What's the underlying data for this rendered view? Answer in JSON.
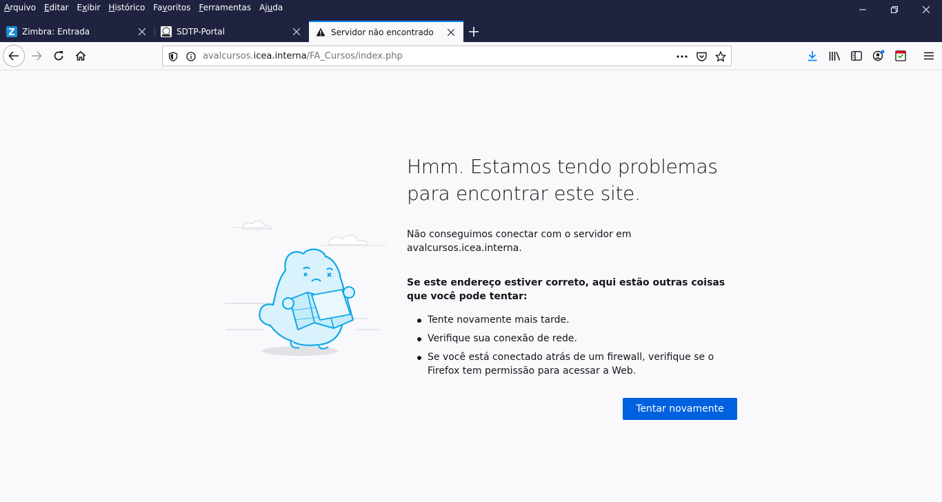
{
  "menubar": {
    "items": [
      {
        "pre": "",
        "key": "A",
        "post": "rquivo"
      },
      {
        "pre": "",
        "key": "E",
        "post": "ditar"
      },
      {
        "pre": "E",
        "key": "x",
        "post": "ibir"
      },
      {
        "pre": "",
        "key": "H",
        "post": "istórico"
      },
      {
        "pre": "Fa",
        "key": "v",
        "post": "oritos"
      },
      {
        "pre": "",
        "key": "F",
        "post": "erramentas"
      },
      {
        "pre": "Aj",
        "key": "u",
        "post": "da"
      }
    ]
  },
  "tabs": [
    {
      "title": "Zimbra: Entrada",
      "icon": "zimbra-icon"
    },
    {
      "title": "SDTP-Portal",
      "icon": "sdtp-icon"
    },
    {
      "title": "Servidor não encontrado",
      "icon": "warning-icon"
    }
  ],
  "urlbar": {
    "prefix": "avalcursos.",
    "domain": "icea.interna",
    "path": "/FA_Cursos/index.php"
  },
  "error": {
    "title_line1": "Hmm. Estamos tendo problemas",
    "title_line2": "para encontrar este site.",
    "lead": "Não conseguimos conectar com o servidor em avalcursos.icea.interna.",
    "subheading": "Se este endereço estiver correto, aqui estão outras coisas que você pode tentar:",
    "tips": [
      "Tente novamente mais tarde.",
      "Verifique sua conexão de rede.",
      "Se você está conectado atrás de um firewall, verifique se o Firefox tem permissão para acessar a Web."
    ],
    "retry_label": "Tentar novamente"
  },
  "colors": {
    "accent": "#0061e0",
    "tab_indicator": "#0a84ff",
    "titlebar": "#202340"
  }
}
